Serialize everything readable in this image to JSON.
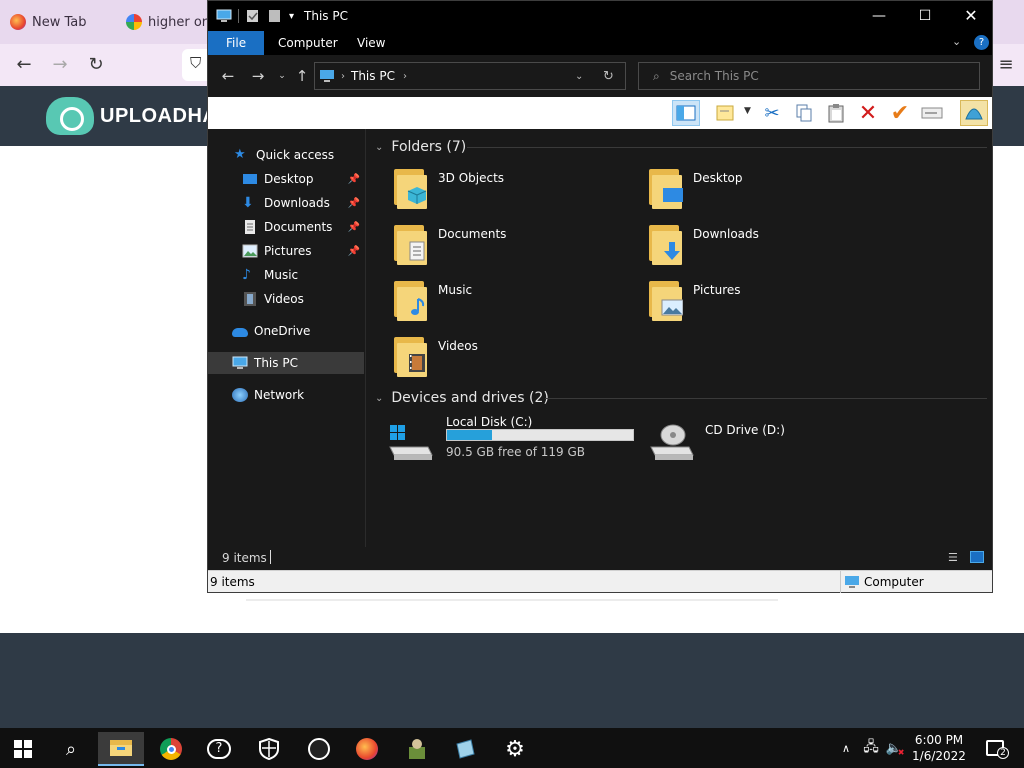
{
  "browser": {
    "tabs": [
      {
        "label": "New Tab"
      },
      {
        "label": "higher or lo"
      }
    ],
    "logo_text": "UPLOADHAV"
  },
  "window": {
    "title": "This PC",
    "ribbon_tabs": [
      "File",
      "Computer",
      "View"
    ],
    "address": {
      "segment": "This PC"
    },
    "search": {
      "placeholder": "Search This PC"
    }
  },
  "nav": {
    "quick_access": "Quick access",
    "items": [
      {
        "label": "Desktop"
      },
      {
        "label": "Downloads"
      },
      {
        "label": "Documents"
      },
      {
        "label": "Pictures"
      },
      {
        "label": "Music"
      },
      {
        "label": "Videos"
      }
    ],
    "onedrive": "OneDrive",
    "this_pc": "This PC",
    "network": "Network"
  },
  "content": {
    "folders_header": "Folders (7)",
    "folders": [
      {
        "label": "3D Objects"
      },
      {
        "label": "Desktop"
      },
      {
        "label": "Documents"
      },
      {
        "label": "Downloads"
      },
      {
        "label": "Music"
      },
      {
        "label": "Pictures"
      },
      {
        "label": "Videos"
      }
    ],
    "drives_header": "Devices and drives (2)",
    "drives": [
      {
        "label": "Local Disk (C:)",
        "free_text": "90.5 GB free of 119 GB",
        "used_fraction": 0.24
      },
      {
        "label": "CD Drive (D:)"
      }
    ]
  },
  "status": {
    "items": "9 items",
    "items2": "9 items",
    "computer": "Computer"
  },
  "taskbar": {
    "time": "6:00 PM",
    "date": "1/6/2022",
    "notifications": "2"
  },
  "colors": {
    "accent": "#1a6fc3",
    "drive_fill": "#26a0da",
    "folder": "#f5d57a"
  }
}
